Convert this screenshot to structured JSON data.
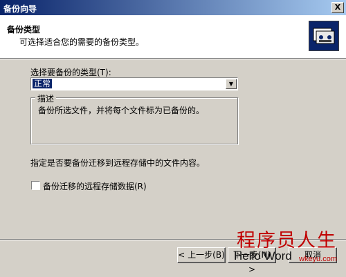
{
  "window": {
    "title": "备份向导",
    "close_label": "X"
  },
  "header": {
    "title": "备份类型",
    "subtitle": "可选择适合您的需要的备份类型。",
    "icon": "backup-tape-icon"
  },
  "form": {
    "type_label": "选择要备份的类型(T):",
    "type_selected": "正常",
    "description_legend": "描述",
    "description_text": "备份所选文件，并将每个文件标为已备份的。",
    "remote_storage_label": "指定是否要备份迁移到远程存储中的文件内容。",
    "remote_storage_checkbox_label": "备份迁移的远程存储数据(R)",
    "remote_storage_checked": false
  },
  "buttons": {
    "back": "< 上一步(B)",
    "next": "下一步(N) >",
    "cancel": "取消"
  },
  "watermark": {
    "chinese": "程序员人生",
    "english": "Hello Word",
    "url": "wkeyu.com"
  },
  "colors": {
    "titlebar": "#0a246a",
    "face": "#d4d0c8",
    "selection": "#0a246a",
    "watermark": "#c00000"
  }
}
